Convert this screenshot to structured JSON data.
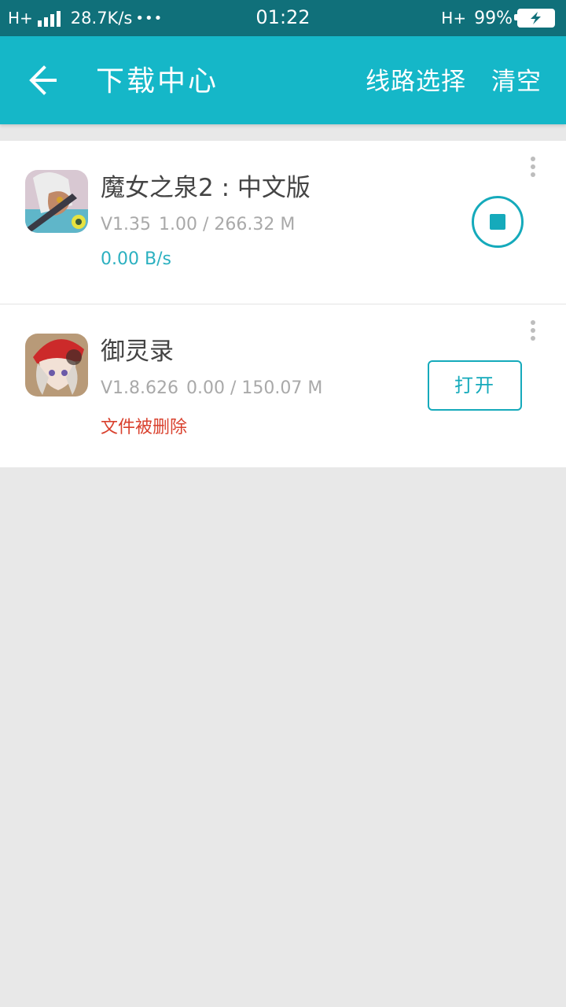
{
  "status_bar": {
    "network_left": "H+",
    "speed": "28.7K/s",
    "dots": "•••",
    "time": "01:22",
    "network_right": "H+",
    "battery_percent": "99%"
  },
  "app_bar": {
    "title": "下载中心",
    "route_select_label": "线路选择",
    "clear_label": "清空",
    "background_color": "#15b7c8"
  },
  "downloads": [
    {
      "name": "魔女之泉2 : 中文版",
      "version": "V1.35",
      "size_progress": "1.00 / 266.32 M",
      "status": "0.00 B/s",
      "status_color": "#2bb0c0",
      "action": "stop",
      "icon": "game-icon-witch"
    },
    {
      "name": "御灵录",
      "version": "V1.8.626",
      "size_progress": "0.00 / 150.07 M",
      "status": "文件被删除",
      "status_color": "#d9412e",
      "action_label": "打开",
      "icon": "game-icon-yulinglu"
    }
  ],
  "accent_color": "#15aabb"
}
